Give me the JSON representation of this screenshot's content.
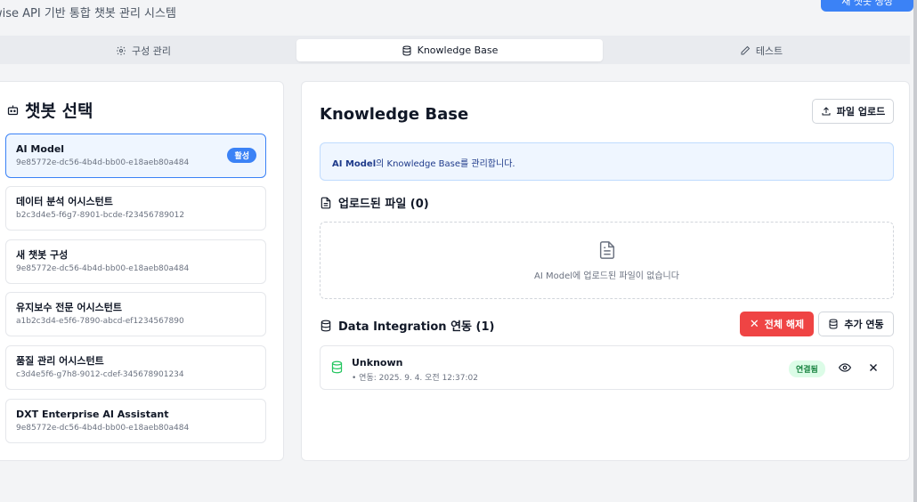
{
  "header": {
    "subtitle": "wise API 기반 통합 챗봇 관리 시스템",
    "top_button_label": "새 챗봇 생성"
  },
  "tabs": [
    {
      "label": "구성 관리",
      "icon": "gear-icon"
    },
    {
      "label": "Knowledge Base",
      "icon": "database-icon",
      "active": true
    },
    {
      "label": "테스트",
      "icon": "pencil-icon"
    }
  ],
  "sidebar": {
    "title": "챗봇 선택",
    "active_badge": "활성",
    "bots": [
      {
        "name": "AI Model",
        "id": "9e85772e-dc56-4b4d-bb00-e18aeb80a484",
        "active": true
      },
      {
        "name": "데이터 분석 어시스턴트",
        "id": "b2c3d4e5-f6g7-8901-bcde-f23456789012"
      },
      {
        "name": "새 챗봇 구성",
        "id": "9e85772e-dc56-4b4d-bb00-e18aeb80a484"
      },
      {
        "name": "유지보수 전문 어시스턴트",
        "id": "a1b2c3d4-e5f6-7890-abcd-ef1234567890"
      },
      {
        "name": "품질 관리 어시스턴트",
        "id": "c3d4e5f6-g7h8-9012-cdef-345678901234"
      },
      {
        "name": "DXT Enterprise AI Assistant",
        "id": "9e85772e-dc56-4b4d-bb00-e18aeb80a484"
      }
    ]
  },
  "main": {
    "title": "Knowledge Base",
    "upload_button": "파일 업로드",
    "info": {
      "bot_name": "AI Model",
      "text": "의 Knowledge Base를 관리합니다."
    },
    "files_title": "업로드된 파일 (0)",
    "empty_text": "AI Model에 업로드된 파일이 없습니다",
    "integration_title": "Data Integration 연동 (1)",
    "remove_all_button": "전체 해제",
    "add_button": "추가 연동",
    "integrations": [
      {
        "name": "Unknown",
        "date": "• 연동: 2025. 9. 4. 오전 12:37:02",
        "status": "연결됨"
      }
    ]
  },
  "colors": {
    "accent": "#3b82f6",
    "danger": "#ef4444",
    "success": "#15803d",
    "info_bg": "#eff6ff"
  }
}
